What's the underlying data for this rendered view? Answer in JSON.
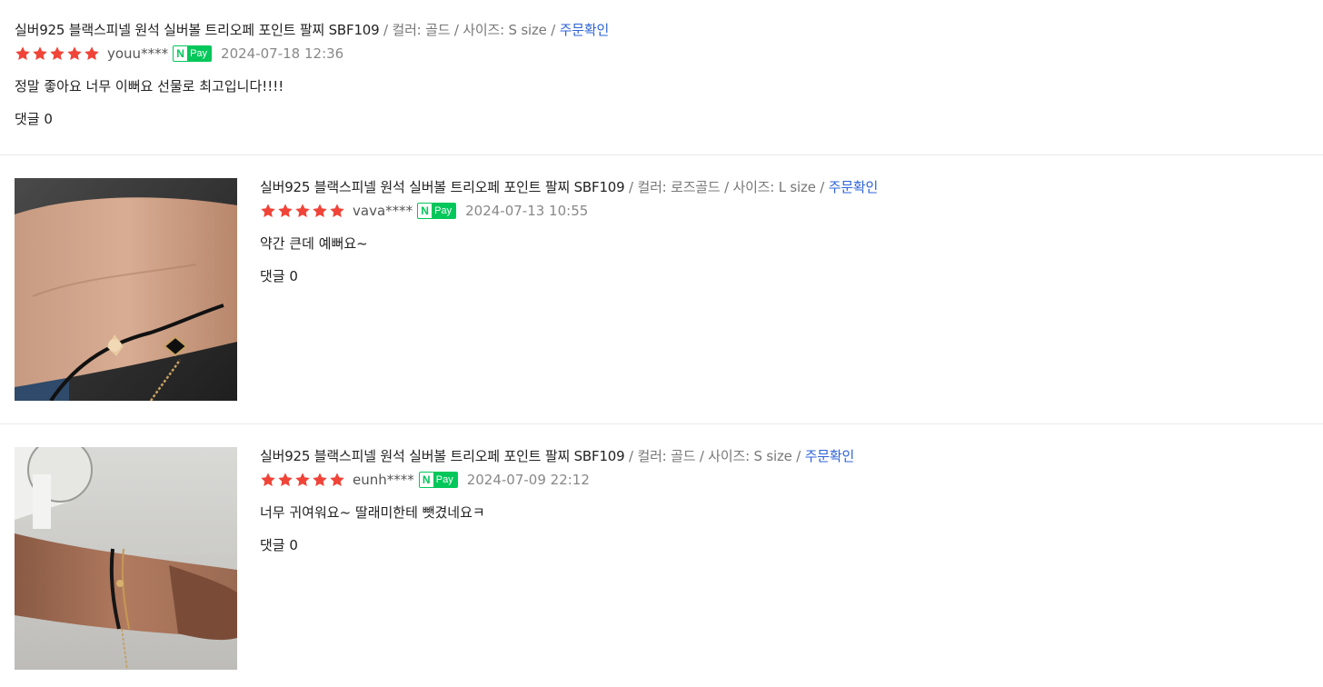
{
  "colors": {
    "star": "#f04438",
    "npay_green": "#03c75a",
    "link_blue": "#2e63d8",
    "muted": "#777777"
  },
  "reviews": [
    {
      "product": "실버925 블랙스피넬 원석 실버볼 트리오페 포인트 팔찌 SBF109",
      "options": " / 컬러: 골드 / 사이즈: S size / ",
      "order_link": "주문확인",
      "rating": 5,
      "user": "youu****",
      "pay_badge_n": "N",
      "pay_badge_text": "Pay",
      "date": "2024-07-18 12:36",
      "body": "정말 좋아요 너무 이뻐요 선물로 최고입니다!!!!",
      "comments": "댓글 0"
    },
    {
      "product": "실버925 블랙스피넬 원석 실버볼 트리오페 포인트 팔찌 SBF109",
      "options": " / 컬러: 로즈골드 / 사이즈: L size / ",
      "order_link": "주문확인",
      "rating": 5,
      "user": "vava****",
      "pay_badge_n": "N",
      "pay_badge_text": "Pay",
      "date": "2024-07-13 10:55",
      "body": "약간 큰데 예뻐요~",
      "comments": "댓글 0"
    },
    {
      "product": "실버925 블랙스피넬 원석 실버볼 트리오페 포인트 팔찌 SBF109",
      "options": " / 컬러: 골드 / 사이즈: S size / ",
      "order_link": "주문확인",
      "rating": 5,
      "user": "eunh****",
      "pay_badge_n": "N",
      "pay_badge_text": "Pay",
      "date": "2024-07-09 22:12",
      "body": "너무 귀여워요~ 딸래미한테 뺏겼네요ㅋ",
      "comments": "댓글 0"
    }
  ]
}
